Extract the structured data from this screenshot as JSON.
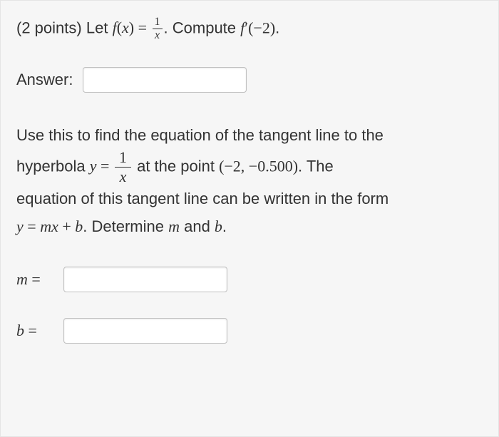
{
  "problem": {
    "points_label": "(2 points)",
    "let_text": "Let",
    "func_lhs_f": "f",
    "func_lhs_paren_open": "(",
    "func_lhs_x": "x",
    "func_lhs_paren_close": ")",
    "equals": " = ",
    "frac_num": "1",
    "frac_den": "x",
    "period_compute": ". Compute",
    "fprime_f": "f",
    "prime_mark": "′",
    "fprime_arg_open": "(",
    "fprime_arg": "−2",
    "fprime_arg_close": ")",
    "final_period": "."
  },
  "answer_label": "Answer:",
  "paragraph": {
    "line1": "Use this to find the equation of the tangent line to the",
    "hyperbola_word": "hyperbola",
    "y_eq_y": "y",
    "y_eq_equals": " = ",
    "frac_num": "1",
    "frac_den": "x",
    "at_point_pre": " at the point ",
    "point": "(−2, −0.500)",
    "point_post": ". The",
    "line3": "equation of this tangent line can be written in the form",
    "form_y": "y",
    "form_eq": " = ",
    "form_m": "m",
    "form_x": "x",
    "form_plus": " + ",
    "form_b": "b",
    "form_post": ". Determine ",
    "det_m": "m",
    "det_and": " and ",
    "det_b": "b",
    "det_period": "."
  },
  "inputs": {
    "answer_value": "",
    "m_label_var": "m",
    "m_label_eq": " =",
    "m_value": "",
    "b_label_var": "b",
    "b_label_eq": " =",
    "b_value": ""
  }
}
